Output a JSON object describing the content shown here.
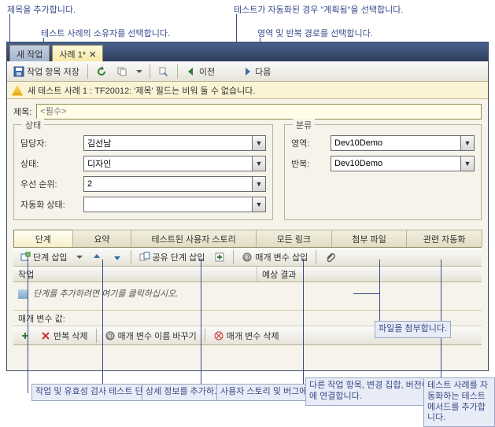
{
  "callouts": {
    "title_hint": "제목을 추가합니다.",
    "owner_hint": "테스트 사례의 소유자를 선택합니다.",
    "automated_hint": "테스트가 자동화된 경우 \"계획됨\"을 선택합니다.",
    "area_hint": "영역 및 반복 경로를 선택합니다.",
    "attach_hint": "파일을\n첨부합니다.",
    "bottom_steps": "작업 및 유효성 검사\n테스트 단계 또는 공유\n단계를 추가합니다.",
    "bottom_summary": "상세 정보를\n추가하고\n기록을 봅니다.",
    "bottom_stories": "사용자 스토리\n및 버그에\n연결합니다.",
    "bottom_links": "다른 작업 항목,\n변경 집합,\n버전이 있는\n항목, URL에\n연결합니다.",
    "bottom_auto": "테스트 사례를\n자동화하는\n테스트 메서드를\n추가합니다."
  },
  "tabs": {
    "inactive": "새 작업",
    "active": "사례 1*"
  },
  "toolbar": {
    "save": "작업 항목 저장",
    "prev": "이전",
    "next": "다음"
  },
  "status": "새 테스트 사례 1 : TF20012: '제목' 필드는 비워 둘 수 없습니다.",
  "title": {
    "label": "제목:",
    "placeholder": "<필수>"
  },
  "group_state": {
    "legend": "상태",
    "owner": {
      "label": "담당자:",
      "value": "김선남"
    },
    "state": {
      "label": "상태:",
      "value": "디자인"
    },
    "priority": {
      "label": "우선 순위:",
      "value": "2"
    },
    "automation": {
      "label": "자동화 상태:",
      "value": ""
    }
  },
  "group_class": {
    "legend": "분류",
    "area": {
      "label": "영역:",
      "value": "Dev10Demo"
    },
    "iteration": {
      "label": "반복:",
      "value": "Dev10Demo"
    }
  },
  "dtabs": [
    "단계",
    "요약",
    "테스트된 사용자 스토리",
    "모든 링크",
    "첨부 파일",
    "관련 자동화"
  ],
  "subbar": {
    "insert_step": "단계 삽입",
    "insert_shared": "공유 단계 삽입",
    "insert_param": "매개 변수 삽입"
  },
  "grid": {
    "col1": "작업",
    "col2": "예상 결과",
    "hint": "단계를 추가하려면 여기를 클릭하십시오."
  },
  "params": {
    "label": "매개 변수 값:"
  },
  "subbar2": {
    "del_iter": "반복 삭제",
    "rename": "매개 변수 이름 바꾸기",
    "del_param": "매개 변수 삭제"
  }
}
